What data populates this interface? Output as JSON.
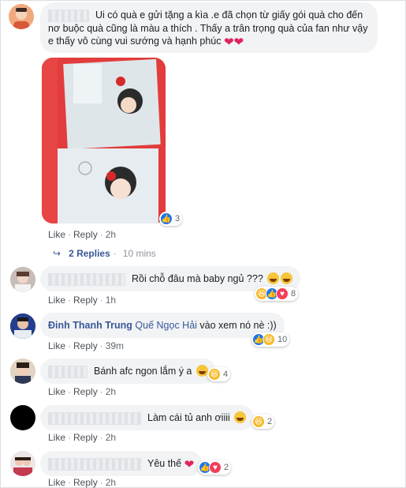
{
  "comments": [
    {
      "text": "Ui có quà e gửi tặng a kìa .e đã chọn từ giấy gói quà cho đến nơ buộc quà cũng là màu a thích . Thấy a trân trọng quà của fan như vậy e thấy vô cùng vui sướng và hạnh phúc",
      "like": "Like",
      "reply": "Reply",
      "time": "2h",
      "reaction_count": "3",
      "emojis": [
        "heart-icon",
        "heart-icon"
      ]
    },
    {
      "text": "Rồi chỗ đâu mà baby ngủ ???",
      "like": "Like",
      "reply": "Reply",
      "time": "1h",
      "reaction_count": "8"
    },
    {
      "author": "Đinh Thanh Trung",
      "tag": "Quế Ngọc Hải",
      "text": "vào xem nó nè :))",
      "like": "Like",
      "reply": "Reply",
      "time": "39m",
      "reaction_count": "10"
    },
    {
      "text": "Bánh afc ngon lắm ý a",
      "like": "Like",
      "reply": "Reply",
      "time": "2h",
      "reaction_count": "4"
    },
    {
      "text": "Làm cái tủ anh ơiiii",
      "like": "Like",
      "reply": "Reply",
      "time": "2h",
      "reaction_count": "2"
    },
    {
      "text": "Yêu thế",
      "like": "Like",
      "reply": "Reply",
      "time": "2h",
      "reaction_count": "2"
    }
  ],
  "replies": {
    "label": "2 Replies",
    "time": "10 mins"
  },
  "colors": {
    "link": "#385898",
    "like": "#1877f2",
    "haha": "#f7b928",
    "love": "#f33e58"
  }
}
